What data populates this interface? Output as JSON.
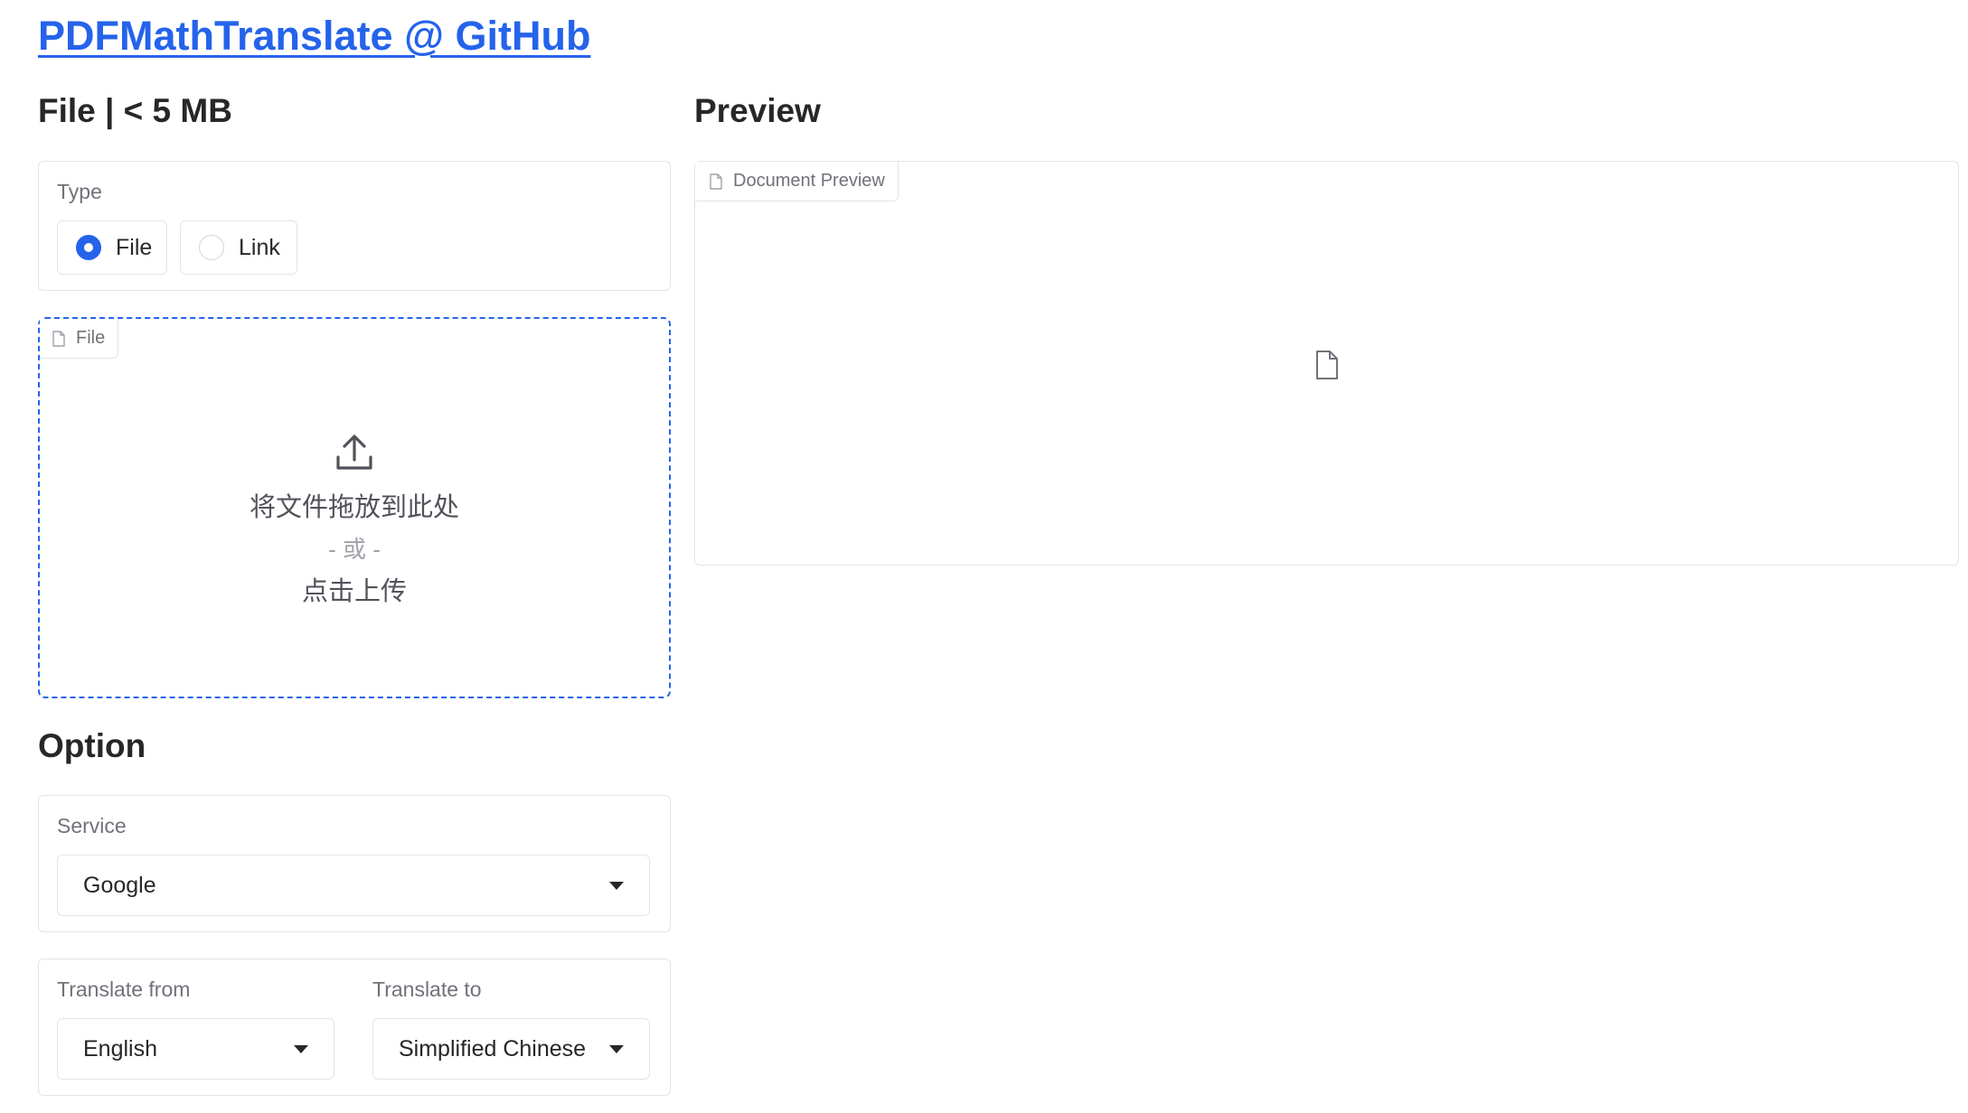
{
  "header": {
    "title_link": "PDFMathTranslate @ GitHub"
  },
  "file_section": {
    "heading": "File | < 5 MB",
    "type_label": "Type",
    "type_options": [
      {
        "label": "File",
        "checked": true
      },
      {
        "label": "Link",
        "checked": false
      }
    ],
    "dropzone": {
      "tag_label": "File",
      "drop_text": "将文件拖放到此处",
      "or_text": "- 或 -",
      "click_text": "点击上传"
    }
  },
  "preview_section": {
    "heading": "Preview",
    "tag_label": "Document Preview"
  },
  "option_section": {
    "heading": "Option",
    "service_label": "Service",
    "service_value": "Google",
    "translate_from_label": "Translate from",
    "translate_from_value": "English",
    "translate_to_label": "Translate to",
    "translate_to_value": "Simplified Chinese"
  },
  "colors": {
    "accent": "#2563eb",
    "border": "#e4e4e7",
    "muted_text": "#71717a"
  },
  "icons": [
    "file-icon",
    "upload-icon",
    "document-icon",
    "chevron-down-icon"
  ]
}
